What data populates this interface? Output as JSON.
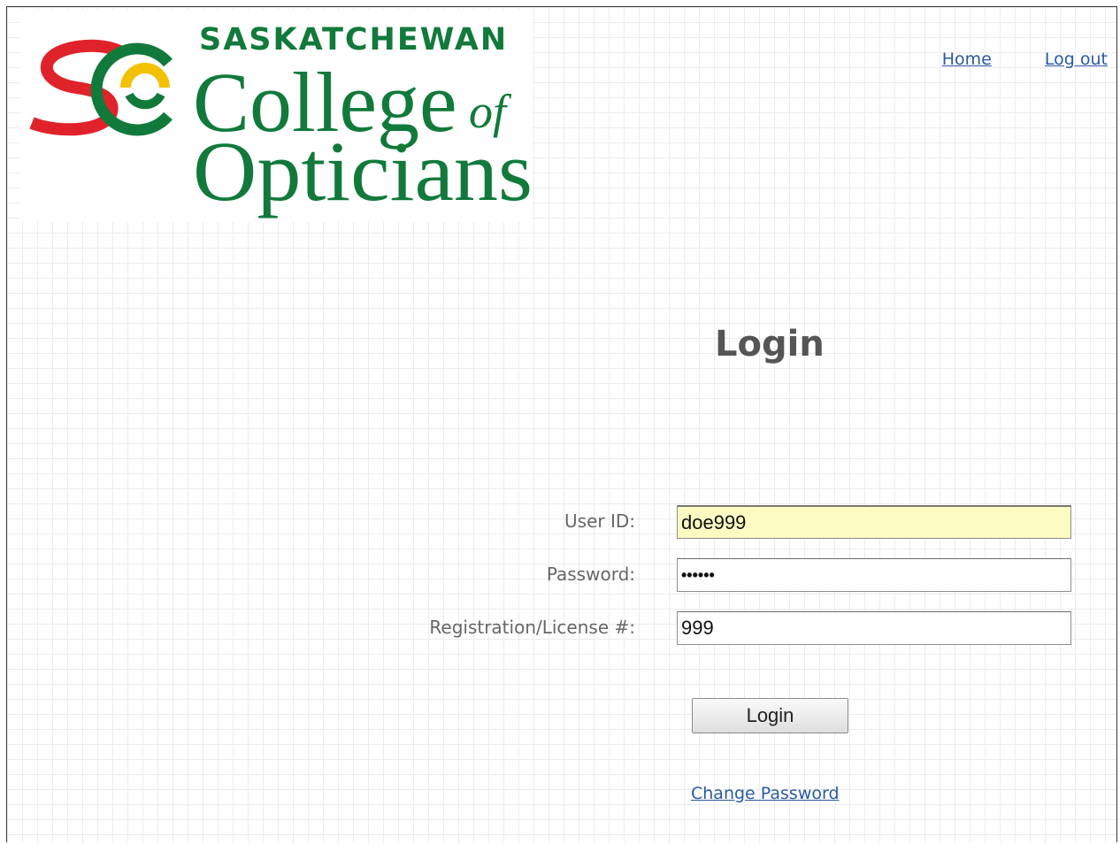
{
  "header": {
    "logo": {
      "monogram": "SC",
      "line1": "SASKATCHEWAN",
      "line2": "College",
      "line2_suffix": "of",
      "line3": "Opticians"
    },
    "nav": {
      "home_label": "Home",
      "logout_label": "Log out"
    }
  },
  "main": {
    "title": "Login",
    "fields": {
      "user_id": {
        "label": "User ID:",
        "value": "doe999"
      },
      "password": {
        "label": "Password:",
        "value": "••••••"
      },
      "license": {
        "label": "Registration/License #:",
        "value": "999"
      }
    },
    "login_button_label": "Login",
    "change_password_label": "Change Password"
  },
  "colors": {
    "brand_green": "#117a3b",
    "brand_red": "#e0232b",
    "brand_yellow": "#f2c200",
    "link_blue": "#2a5aa0",
    "highlight_yellow": "#fcfcc2"
  }
}
